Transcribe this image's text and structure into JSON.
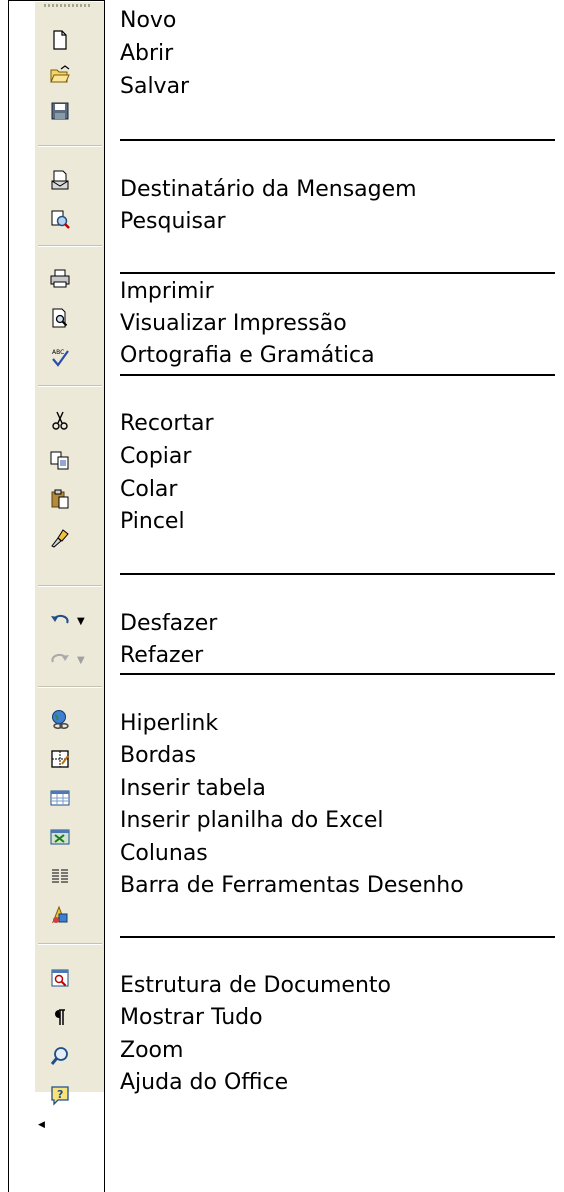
{
  "labels": {
    "novo": "Novo",
    "abrir": "Abrir",
    "salvar": "Salvar",
    "destinatario": "Destinatário da Mensagem",
    "pesquisar": "Pesquisar",
    "imprimir": "Imprimir",
    "visualizar": "Visualizar Impressão",
    "ortografia": "Ortografia e Gramática",
    "recortar": "Recortar",
    "copiar": "Copiar",
    "colar": "Colar",
    "pincel": "Pincel",
    "desfazer": "Desfazer",
    "refazer": "Refazer",
    "hiperlink": "Hiperlink",
    "bordas": "Bordas",
    "inserir_tabela": "Inserir tabela",
    "inserir_planilha": "Inserir planilha do Excel",
    "colunas": "Colunas",
    "barra_desenho": "Barra de Ferramentas Desenho",
    "estrutura": "Estrutura de Documento",
    "mostrar_tudo": "Mostrar Tudo",
    "zoom": "Zoom",
    "ajuda": "Ajuda do Office"
  },
  "icons": {
    "novo": "new-document-icon",
    "abrir": "open-folder-icon",
    "salvar": "save-disk-icon",
    "destinatario": "mail-recipient-icon",
    "pesquisar": "search-document-icon",
    "imprimir": "printer-icon",
    "visualizar": "print-preview-icon",
    "ortografia": "spelling-check-icon",
    "recortar": "scissors-icon",
    "copiar": "copy-icon",
    "colar": "paste-icon",
    "pincel": "format-painter-icon",
    "desfazer": "undo-icon",
    "refazer": "redo-icon",
    "hiperlink": "hyperlink-globe-icon",
    "bordas": "borders-icon",
    "inserir_tabela": "insert-table-icon",
    "inserir_planilha": "insert-excel-sheet-icon",
    "colunas": "columns-icon",
    "barra_desenho": "drawing-toolbar-icon",
    "estrutura": "document-map-icon",
    "mostrar_tudo": "pilcrow-icon",
    "zoom": "magnifier-icon",
    "ajuda": "help-icon"
  },
  "colors": {
    "toolbar_bg": "#ece9d8",
    "separator": "#c5c2b2"
  }
}
